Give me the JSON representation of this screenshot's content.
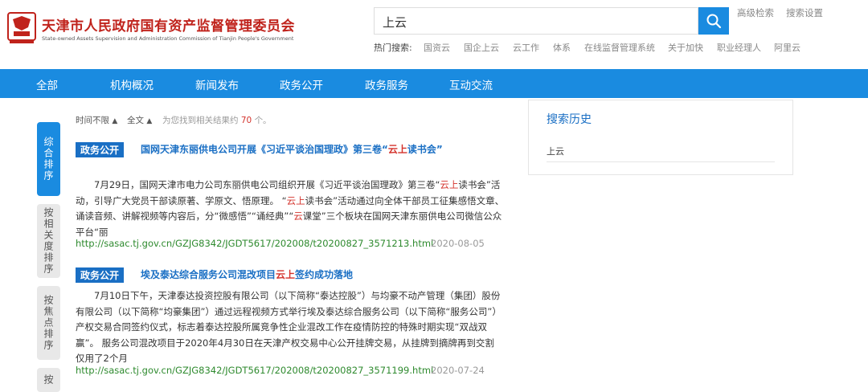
{
  "header": {
    "org_title": "天津市人民政府国有资产监督管理委员会",
    "org_subtitle": "State-owned Assets Supervision and Administration Commission of Tianjin People's Government",
    "search_value": "上云",
    "advanced_search": "高级检索",
    "search_settings": "搜索设置",
    "hot_label": "热门搜索:",
    "hot_items": [
      "国资云",
      "国企上云",
      "云工作",
      "体系",
      "在线监督管理系统",
      "关于加快",
      "职业经理人",
      "阿里云"
    ]
  },
  "nav": {
    "items": [
      "全部",
      "机构概况",
      "新闻发布",
      "政务公开",
      "政务服务",
      "互动交流"
    ]
  },
  "sidebar": {
    "tabs": [
      "综合排序",
      "按相关度排序",
      "按焦点排序",
      "按"
    ]
  },
  "filters": {
    "time": "时间不限",
    "scope": "全文",
    "count_prefix": "为您找到相关结果约",
    "count": "70",
    "count_suffix": "个。"
  },
  "results": [
    {
      "badge": "政务公开",
      "title_parts": [
        "国网天津东丽供电公司开展《习近平谈治国理政》第三卷“",
        "云上",
        "读书会”"
      ],
      "body_parts": [
        "7月29日，国网天津市电力公司东丽供电公司组织开展《习近平谈治国理政》第三卷“",
        "云上",
        "读书会”活动，引导广大党员干部读原著、学原文、悟原理。        “",
        "云上",
        "读书会”活动通过向全体干部员工征集感悟文章、诵读音频、讲解视频等内容后，分“微感悟”“诵经典”“",
        "云",
        "课堂”三个板块在国网天津东丽供电公司微信公众平台“丽"
      ],
      "url": "http://sasac.tj.gov.cn/GZJG8342/JGDT5617/202008/t20200827_3571213.html",
      "date": "2020-08-05"
    },
    {
      "badge": "政务公开",
      "title_parts": [
        "埃及泰达综合服务公司混改项目",
        "云上",
        "签约成功落地"
      ],
      "body": "7月10日下午，天津泰达投资控股有限公司（以下简称“泰达控股”）与均豪不动产管理（集团）股份有限公司（以下简称“均豪集团”）通过远程视频方式举行埃及泰达综合服务公司（以下简称“服务公司”）产权交易合同签约仪式，标志着泰达控股所属竞争性企业混改工作在疫情防控的特殊时期实现“双战双赢”。        服务公司混改项目于2020年4月30日在天津产权交易中心公开挂牌交易，从挂牌到摘牌再到交割仅用了2个月",
      "url": "http://sasac.tj.gov.cn/GZJG8342/JGDT5617/202008/t20200827_3571199.html",
      "date": "2020-07-24"
    }
  ],
  "history": {
    "title": "搜索历史",
    "items": [
      "上云"
    ]
  },
  "colors": {
    "accent": "#1a8be0",
    "badge": "#1a6fc4",
    "highlight": "#d4332c",
    "url": "#2e8a2e",
    "brand_red": "#c0231c"
  },
  "icons": [
    "emblem-logo",
    "search-icon",
    "sort-arrow-icon"
  ]
}
